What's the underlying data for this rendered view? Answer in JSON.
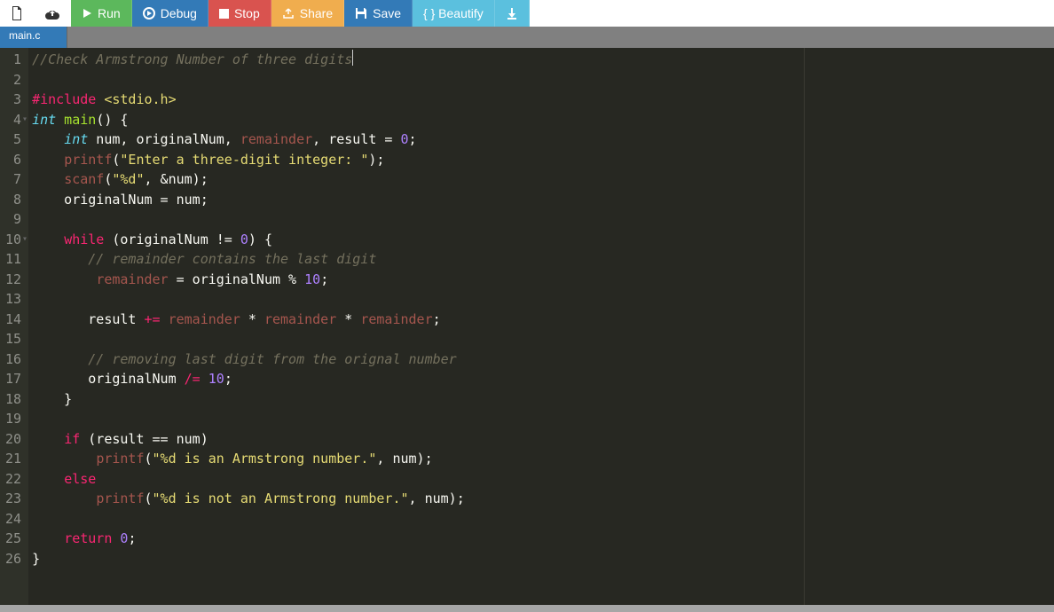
{
  "toolbar": {
    "run": "Run",
    "debug": "Debug",
    "stop": "Stop",
    "share": "Share",
    "save": "Save",
    "beautify": "{ } Beautify"
  },
  "tabs": [
    {
      "label": "main.c"
    }
  ],
  "gutter": [
    "1",
    "2",
    "3",
    "4",
    "5",
    "6",
    "7",
    "8",
    "9",
    "10",
    "11",
    "12",
    "13",
    "14",
    "15",
    "16",
    "17",
    "18",
    "19",
    "20",
    "21",
    "22",
    "23",
    "24",
    "25",
    "26"
  ],
  "code": {
    "l1": "//Check Armstrong Number of three digits",
    "l3_inc": "#include ",
    "l3_hdr": "<stdio.h>",
    "l4_int": "int",
    "l4_main": " main",
    "l4_rest": "() {",
    "l5_int": "int",
    "l5_vars": " num, originalNum, ",
    "l5_rem": "remainder",
    "l5_rest": ", result = ",
    "l5_zero": "0",
    "l6_pf": "printf",
    "l6_str": "\"Enter a three-digit integer: \"",
    "l7_sc": "scanf",
    "l7_str": "\"%d\"",
    "l7_rest": ", &num);",
    "l8": "    originalNum = num;",
    "l10_while": "while",
    "l10_cond": " (originalNum != ",
    "l10_zero": "0",
    "l10_rest": ") {",
    "l11": "// remainder contains the last digit",
    "l12_rem": "remainder",
    "l12_eq": " = originalNum % ",
    "l12_ten": "10",
    "l14_a": "       result ",
    "l14_op": "+=",
    "l14_sp": " ",
    "l14_rem": "remainder",
    "l14_st": " * ",
    "l16": "// removing last digit from the orignal number",
    "l17_a": "       originalNum ",
    "l17_op": "/=",
    "l17_sp": " ",
    "l17_ten": "10",
    "l18": "    }",
    "l20_if": "if",
    "l20_rest": " (result == num)",
    "l21_pf": "printf",
    "l21_str": "\"%d is an Armstrong number.\"",
    "l21_rest": ", num);",
    "l22_else": "else",
    "l23_pf": "printf",
    "l23_str": "\"%d is not an Armstrong number.\"",
    "l23_rest": ", num);",
    "l25_ret": "return",
    "l25_zero": "0",
    "l26": "}"
  }
}
